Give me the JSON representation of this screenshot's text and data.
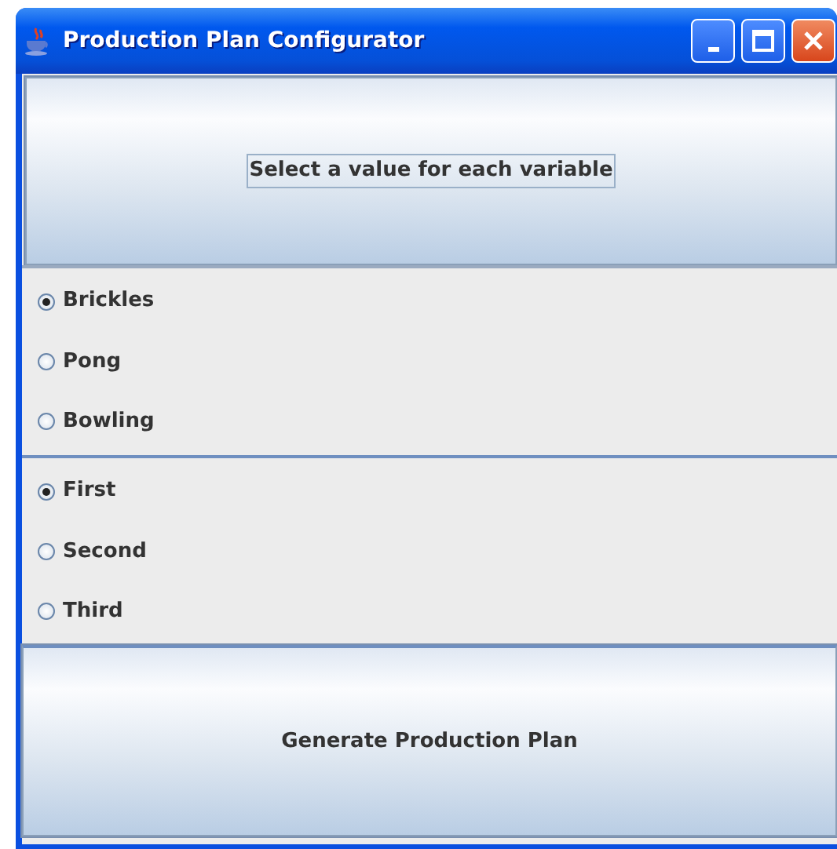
{
  "window": {
    "title": "Production Plan Configurator"
  },
  "prompt_button": {
    "label": "Select a value for each variable",
    "focused": true
  },
  "groups": [
    {
      "options": [
        {
          "label": "Brickles",
          "selected": true
        },
        {
          "label": "Pong",
          "selected": false
        },
        {
          "label": "Bowling",
          "selected": false
        }
      ]
    },
    {
      "options": [
        {
          "label": "First",
          "selected": true
        },
        {
          "label": "Second",
          "selected": false
        },
        {
          "label": "Third",
          "selected": false
        }
      ]
    }
  ],
  "generate_button": {
    "label": "Generate Production Plan"
  }
}
